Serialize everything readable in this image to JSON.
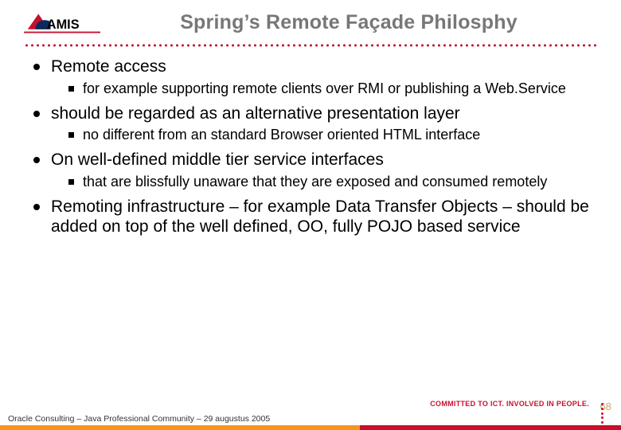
{
  "logo_text": "AMIS",
  "title": "Spring’s Remote Façade Philosphy",
  "bullets": [
    {
      "text": "Remote access",
      "sub": [
        "for example supporting remote clients over RMI or publishing a Web.Service"
      ]
    },
    {
      "text": "should be regarded as an alternative presentation layer",
      "sub": [
        "no different from an standard Browser oriented HTML interface"
      ]
    },
    {
      "text": "On well-defined middle tier service interfaces",
      "sub": [
        "that are blissfully unaware that they are exposed and consumed remotely"
      ]
    },
    {
      "text": "Remoting infrastructure – for example Data Transfer Objects – should be added on top of the well defined, OO, fully POJO based service",
      "sub": []
    }
  ],
  "footer_tagline": "COMMITTED TO ICT. INVOLVED IN PEOPLE.",
  "footer_line": "Oracle Consulting – Java Professional Community – 29 augustus 2005",
  "page_number": "68"
}
